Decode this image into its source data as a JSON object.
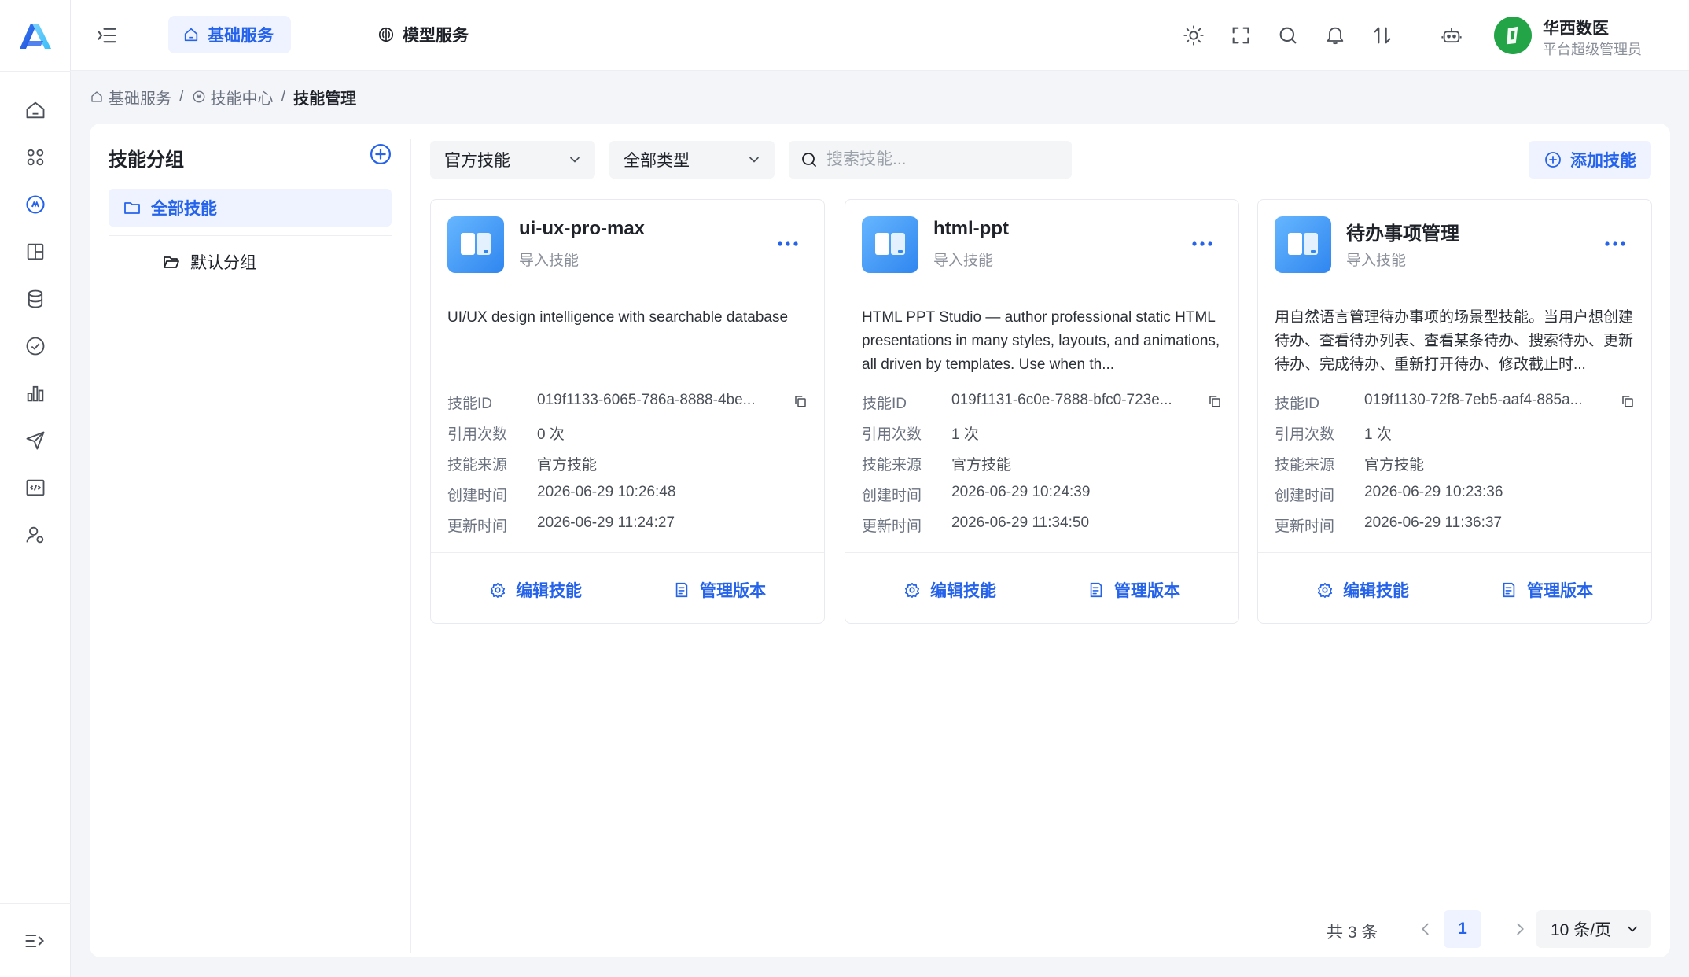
{
  "app": {
    "logo": "app-logo"
  },
  "colors": {
    "accent": "#2563eb",
    "accent_bg": "#eef3ff",
    "avatar_bg": "#22a447",
    "card_icon": "#3d95f5"
  },
  "sidebar": {
    "items": [
      {
        "icon": "home-icon"
      },
      {
        "icon": "apps-icon"
      },
      {
        "icon": "skill-center-icon",
        "active": true
      },
      {
        "icon": "layout-icon"
      },
      {
        "icon": "database-icon"
      },
      {
        "icon": "check-circle-icon"
      },
      {
        "icon": "bar-chart-icon"
      },
      {
        "icon": "send-icon"
      },
      {
        "icon": "code-icon"
      },
      {
        "icon": "user-settings-icon"
      }
    ],
    "collapse_icon": "collapse-sidebar-icon"
  },
  "header": {
    "tabs": [
      {
        "label": "基础服务",
        "icon": "home-icon",
        "active": true
      },
      {
        "label": "模型服务",
        "icon": "model-icon",
        "active": false
      }
    ],
    "icons": [
      "sun-icon",
      "fullscreen-icon",
      "search-icon",
      "bell-icon",
      "sort-icon",
      "robot-icon"
    ],
    "user": {
      "name": "华西数医",
      "role": "平台超级管理员"
    }
  },
  "breadcrumb": {
    "items": [
      "基础服务",
      "技能中心",
      "技能管理"
    ],
    "separator": "/"
  },
  "groups": {
    "title": "技能分组",
    "items": [
      {
        "label": "全部技能",
        "active": true
      },
      {
        "label": "默认分组",
        "active": false
      }
    ]
  },
  "toolbar": {
    "source_filter": "官方技能",
    "type_filter": "全部类型",
    "search_placeholder": "搜索技能...",
    "add_label": "添加技能"
  },
  "meta_labels": {
    "id": "技能ID",
    "refs": "引用次数",
    "source": "技能来源",
    "created": "创建时间",
    "updated": "更新时间"
  },
  "card_actions": {
    "edit": "编辑技能",
    "versions": "管理版本"
  },
  "cards": [
    {
      "name": "ui-ux-pro-max",
      "subtitle": "导入技能",
      "description": "UI/UX design intelligence with searchable database",
      "id": "019f1133-6065-786a-8888-4be...",
      "refs": "0 次",
      "source": "官方技能",
      "created": "2026-06-29 10:26:48",
      "updated": "2026-06-29 11:24:27"
    },
    {
      "name": "html-ppt",
      "subtitle": "导入技能",
      "description": "HTML PPT Studio — author professional static HTML presentations in many styles, layouts, and animations, all driven by templates. Use when th...",
      "id": "019f1131-6c0e-7888-bfc0-723e...",
      "refs": "1 次",
      "source": "官方技能",
      "created": "2026-06-29 10:24:39",
      "updated": "2026-06-29 11:34:50"
    },
    {
      "name": "待办事项管理",
      "subtitle": "导入技能",
      "description": "用自然语言管理待办事项的场景型技能。当用户想创建待办、查看待办列表、查看某条待办、搜索待办、更新待办、完成待办、重新打开待办、修改截止时...",
      "id": "019f1130-72f8-7eb5-aaf4-885a...",
      "refs": "1 次",
      "source": "官方技能",
      "created": "2026-06-29 10:23:36",
      "updated": "2026-06-29 11:36:37"
    }
  ],
  "pagination": {
    "total": "共 3 条",
    "current": "1",
    "page_size": "10 条/页"
  }
}
